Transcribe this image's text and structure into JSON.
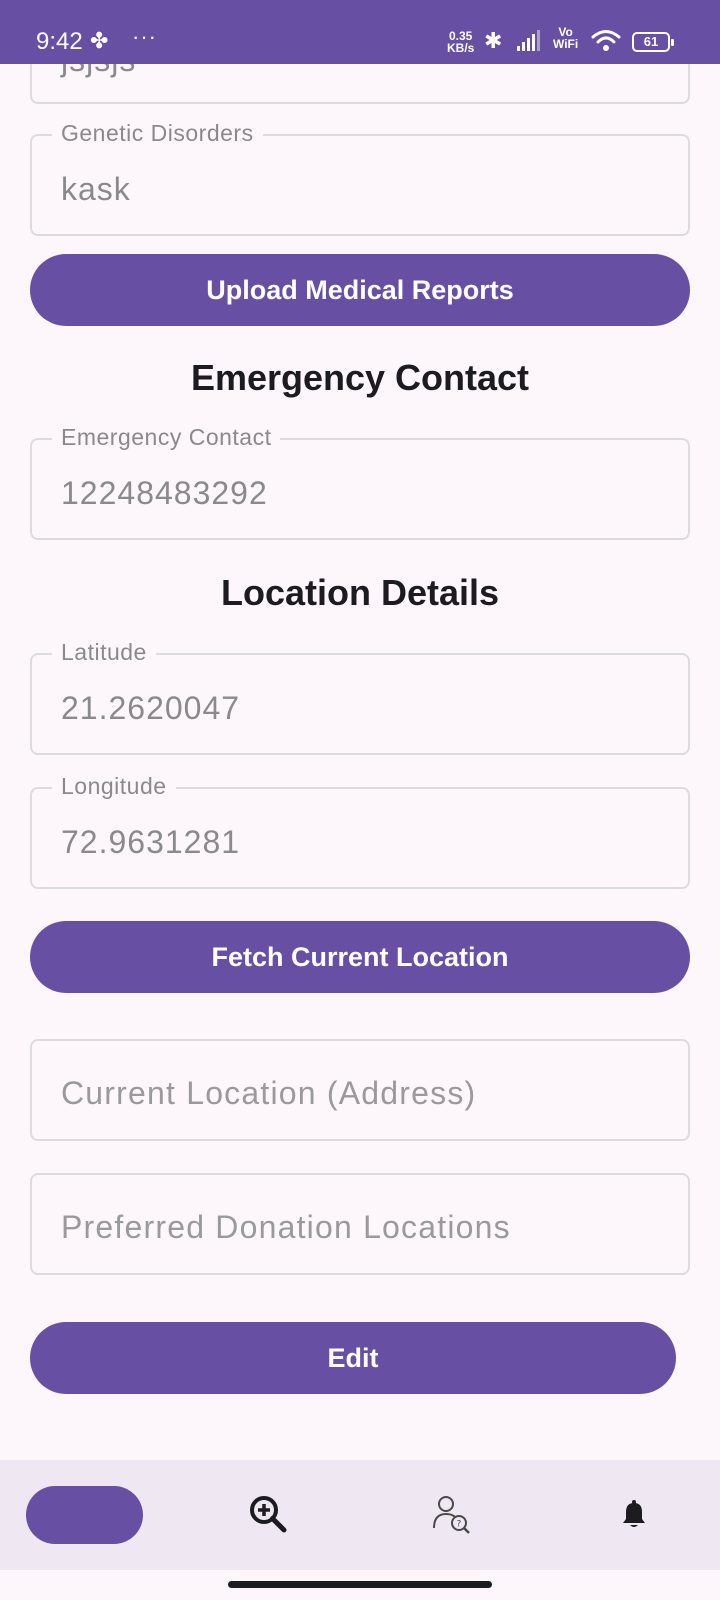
{
  "status_bar": {
    "time": "9:42",
    "speed_value": "0.35",
    "speed_unit": "KB/s",
    "vowifi_top": "Vo",
    "vowifi_bottom": "WiFi",
    "battery": "61"
  },
  "medical": {
    "partial_field_value": "jsjsjs",
    "genetic_disorders": {
      "label": "Genetic Disorders",
      "value": "kask"
    },
    "upload_button": "Upload Medical Reports"
  },
  "emergency": {
    "title": "Emergency Contact",
    "field": {
      "label": "Emergency Contact",
      "value": "12248483292"
    }
  },
  "location": {
    "title": "Location Details",
    "latitude": {
      "label": "Latitude",
      "value": "21.2620047"
    },
    "longitude": {
      "label": "Longitude",
      "value": "72.9631281"
    },
    "fetch_button": "Fetch Current Location",
    "address_placeholder": "Current Location (Address)",
    "donation_placeholder": "Preferred Donation Locations"
  },
  "edit_button": "Edit",
  "bottom_nav": {
    "items": [
      {
        "icon": "home-icon",
        "active": true
      },
      {
        "icon": "search-plus-icon",
        "active": false
      },
      {
        "icon": "person-search-icon",
        "active": false
      },
      {
        "icon": "notification-bell-icon",
        "active": false
      }
    ]
  },
  "colors": {
    "primary": "#6750a4",
    "background": "#fdf7fc",
    "nav_background": "#efe8f2"
  }
}
